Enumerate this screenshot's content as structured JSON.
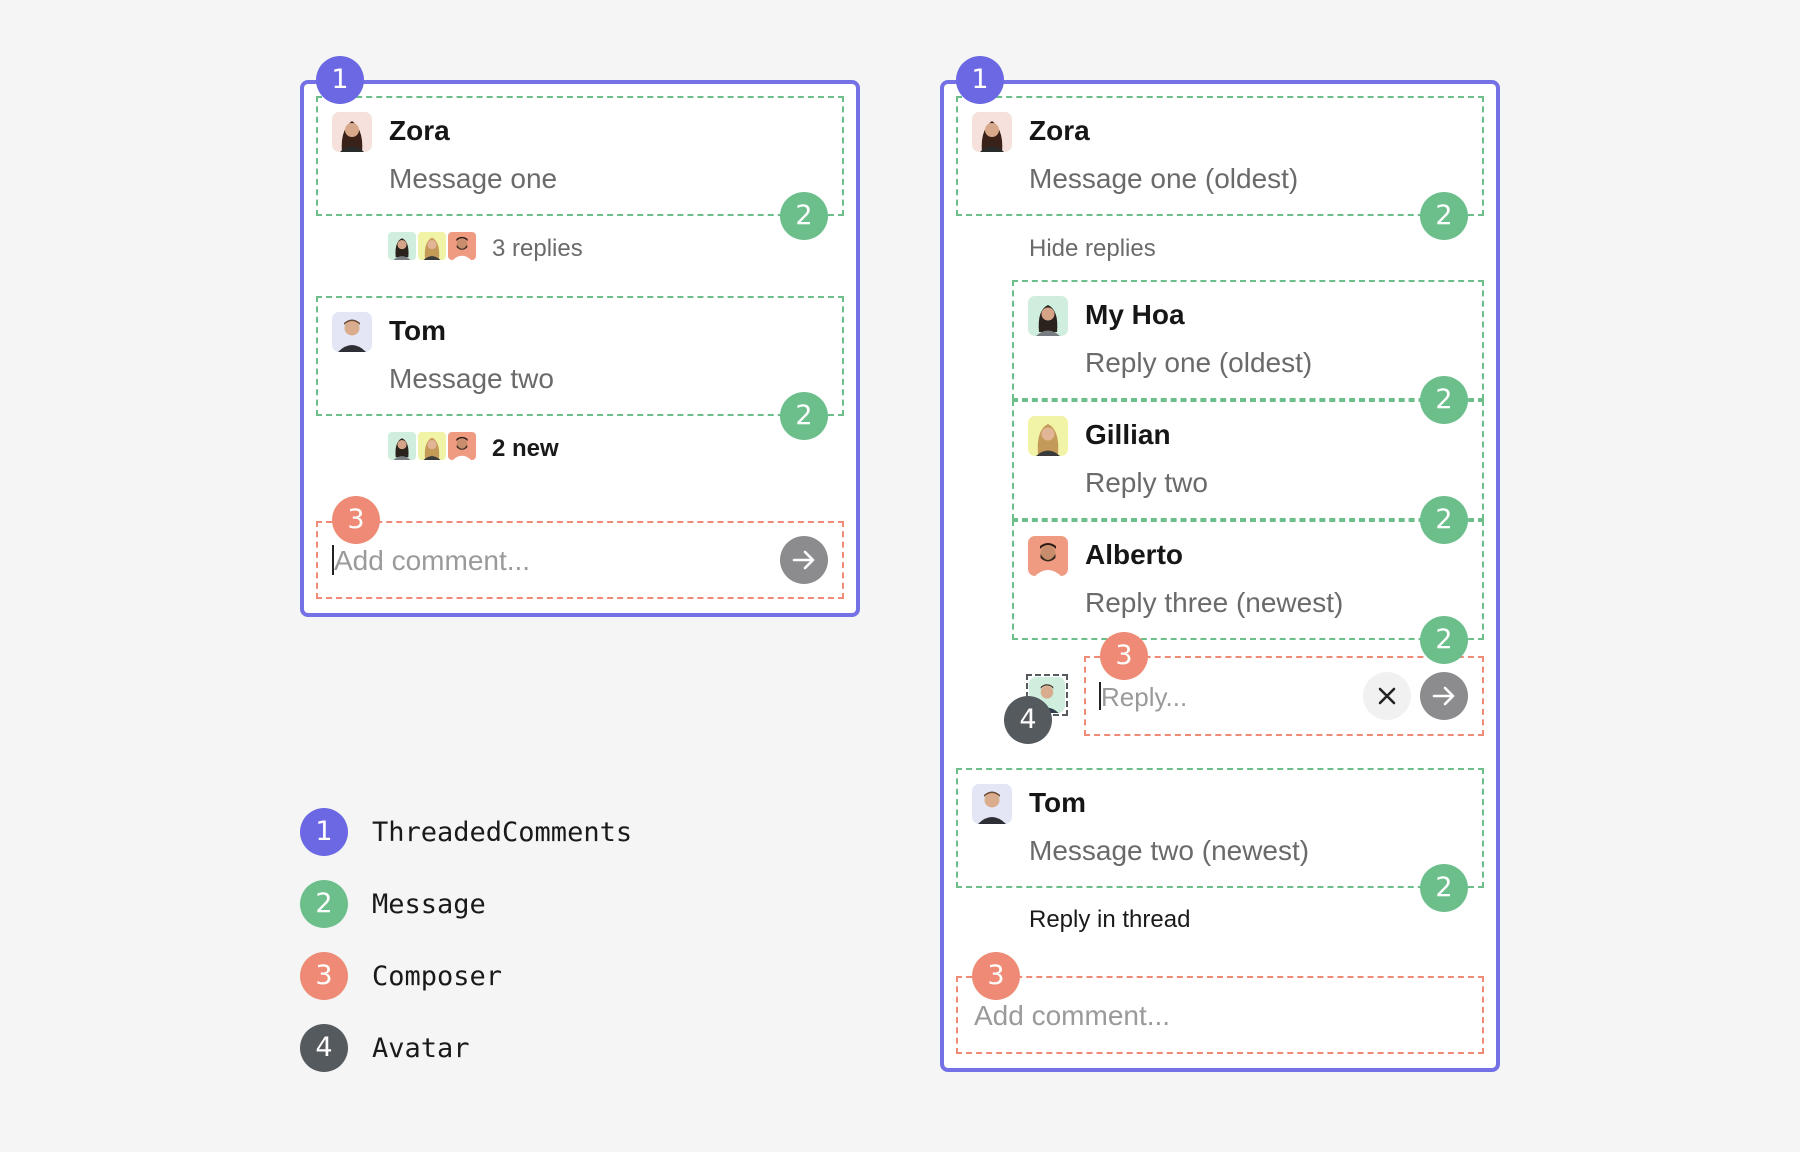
{
  "left": {
    "badge_panel": "1",
    "msg1": {
      "name": "Zora",
      "text": "Message one",
      "badge": "2",
      "replies_label": "3 replies"
    },
    "msg2": {
      "name": "Tom",
      "text": "Message two",
      "badge": "2",
      "replies_label": "2 new"
    },
    "composer": {
      "badge": "3",
      "placeholder": "Add comment..."
    }
  },
  "right": {
    "badge_panel": "1",
    "msg1": {
      "name": "Zora",
      "text": "Message one (oldest)",
      "badge": "2",
      "toggle_label": "Hide replies"
    },
    "replies": [
      {
        "name": "My Hoa",
        "text": "Reply one (oldest)",
        "badge": "2"
      },
      {
        "name": "Gillian",
        "text": "Reply two",
        "badge": "2"
      },
      {
        "name": "Alberto",
        "text": "Reply three (newest)",
        "badge": "2"
      }
    ],
    "reply_composer": {
      "badge": "3",
      "avatar_badge": "4",
      "placeholder": "Reply..."
    },
    "msg2": {
      "name": "Tom",
      "text": "Message two (newest)",
      "badge": "2",
      "thread_label": "Reply in thread"
    },
    "composer": {
      "badge": "3",
      "placeholder": "Add comment..."
    }
  },
  "legend": [
    {
      "num": "1",
      "label": "ThreadedComments",
      "color": "#6c68e4"
    },
    {
      "num": "2",
      "label": "Message",
      "color": "#6cbf8b"
    },
    {
      "num": "3",
      "label": "Composer",
      "color": "#ee8a76"
    },
    {
      "num": "4",
      "label": "Avatar",
      "color": "#555a5f"
    }
  ],
  "colors": {
    "panel_border": "#7470e6",
    "message_outline": "#6cbf8b",
    "composer_outline": "#ee8a76",
    "avatar_outline": "#555a5f",
    "background": "#f5f5f5"
  },
  "icons": [
    "arrow-right-icon",
    "close-icon"
  ]
}
